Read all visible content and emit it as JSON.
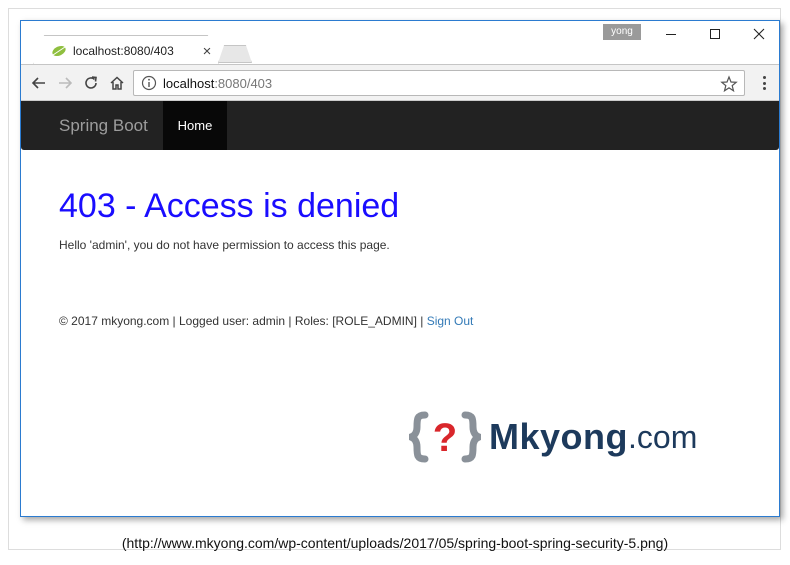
{
  "browser": {
    "tab_title": "localhost:8080/403",
    "tab_close": "×",
    "user_badge": "yong",
    "url_host": "localhost",
    "url_rest": ":8080/403"
  },
  "navbar": {
    "brand": "Spring Boot",
    "home": "Home",
    "color": "#222222"
  },
  "content": {
    "heading": "403 - Access is denied",
    "message": "Hello 'admin', you do not have permission to access this page.",
    "footer_text": "© 2017 mkyong.com | Logged user: admin | Roles: [ROLE_ADMIN] | ",
    "signout": "Sign Out",
    "heading_color": "#1a0dff",
    "link_color": "#337ab7"
  },
  "logo": {
    "mark": "?",
    "word": "Mkyong",
    "domain": ".com"
  },
  "caption": "(http://www.mkyong.com/wp-content/uploads/2017/05/spring-boot-spring-security-5.png)",
  "icons": [
    "spring-leaf-icon",
    "back-arrow-icon",
    "forward-arrow-icon",
    "reload-icon",
    "home-icon",
    "info-icon",
    "star-icon",
    "menu-dots-icon",
    "minimize-icon",
    "maximize-icon",
    "close-icon",
    "mkyong-logo-icon"
  ]
}
